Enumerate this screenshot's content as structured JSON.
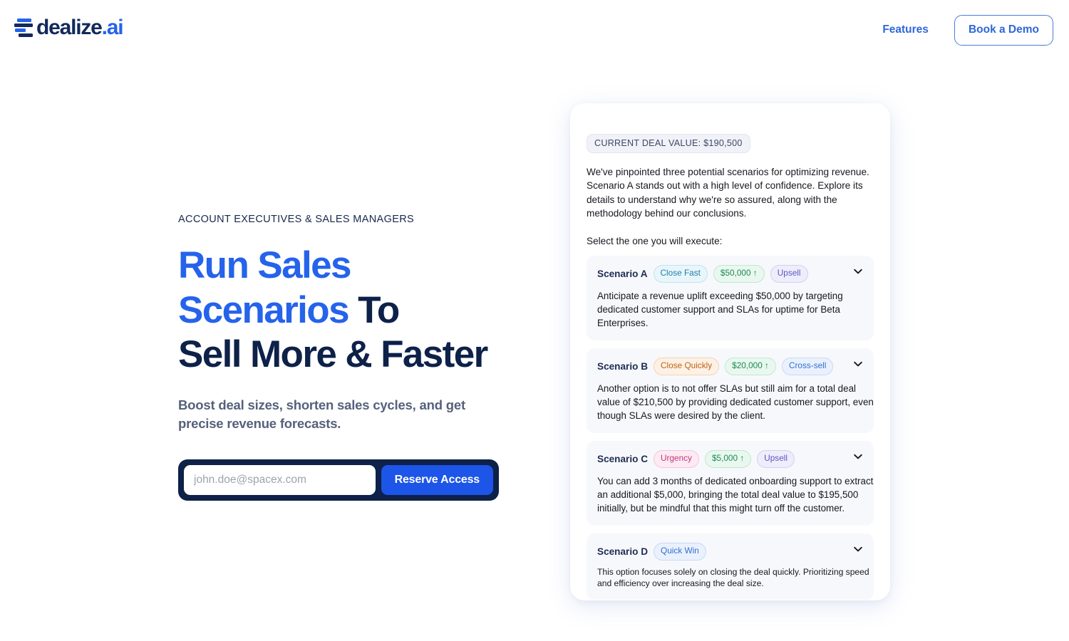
{
  "header": {
    "logo_text": "dealize",
    "logo_suffix": ".ai",
    "logo_mark_icon": "stacked-bars-icon",
    "nav_link": "Features",
    "demo_button": "Book a Demo"
  },
  "hero": {
    "eyebrow": "ACCOUNT EXECUTIVES & SALES MANAGERS",
    "headline_line1_accent": "Run Sales",
    "headline_line2_accent": "Scenarios",
    "headline_line2_rest": " To",
    "headline_line3": "Sell More & Faster",
    "subhead": "Boost deal sizes, shorten sales cycles, and get precise revenue forecasts.",
    "email_placeholder": "john.doe@spacex.com",
    "email_value": "",
    "reserve_button": "Reserve Access"
  },
  "panel": {
    "deal_value_pill": "CURRENT DEAL VALUE: $190,500",
    "intro": "We've pinpointed three potential scenarios for optimizing revenue. Scenario A stands out with a high level of confidence. Explore its details to understand why we're so assured, along with the methodology behind our conclusions.",
    "select_prompt": "Select the one you will execute:",
    "chevron_icon": "chevron-down-icon",
    "scenarios": [
      {
        "title": "Scenario A",
        "tags": [
          {
            "label": "Close Fast",
            "style": "tag-cyan"
          },
          {
            "label": "$50,000 ↑",
            "style": "tag-green"
          },
          {
            "label": "Upsell",
            "style": "tag-indigo"
          }
        ],
        "description": "Anticipate a revenue uplift exceeding $50,000 by targeting dedicated customer support and SLAs for uptime for Beta Enterprises."
      },
      {
        "title": "Scenario B",
        "tags": [
          {
            "label": "Close Quickly",
            "style": "tag-orange"
          },
          {
            "label": "$20,000 ↑",
            "style": "tag-green"
          },
          {
            "label": "Cross-sell",
            "style": "tag-blue"
          }
        ],
        "description": "Another option is to not offer SLAs but still aim for a total deal value of $210,500 by providing dedicated customer support, even though SLAs were desired by the client."
      },
      {
        "title": "Scenario C",
        "tags": [
          {
            "label": "Urgency",
            "style": "tag-pink"
          },
          {
            "label": "$5,000 ↑",
            "style": "tag-green"
          },
          {
            "label": "Upsell",
            "style": "tag-indigo"
          }
        ],
        "description": "You can add 3 months of dedicated onboarding support to extract an additional $5,000, bringing the total deal value to $195,500 initially, but be mindful that this might turn off the customer."
      },
      {
        "title": "Scenario D",
        "tags": [
          {
            "label": "Quick Win",
            "style": "tag-blue"
          }
        ],
        "description": "This option focuses solely on closing the deal quickly. Prioritizing speed and efficiency over increasing the deal size.",
        "small_text": true
      }
    ]
  },
  "colors": {
    "accent_blue": "#2563eb",
    "navy": "#0d2149",
    "button_blue": "#1d55e8",
    "panel_card_bg": "#f7f8fc"
  }
}
